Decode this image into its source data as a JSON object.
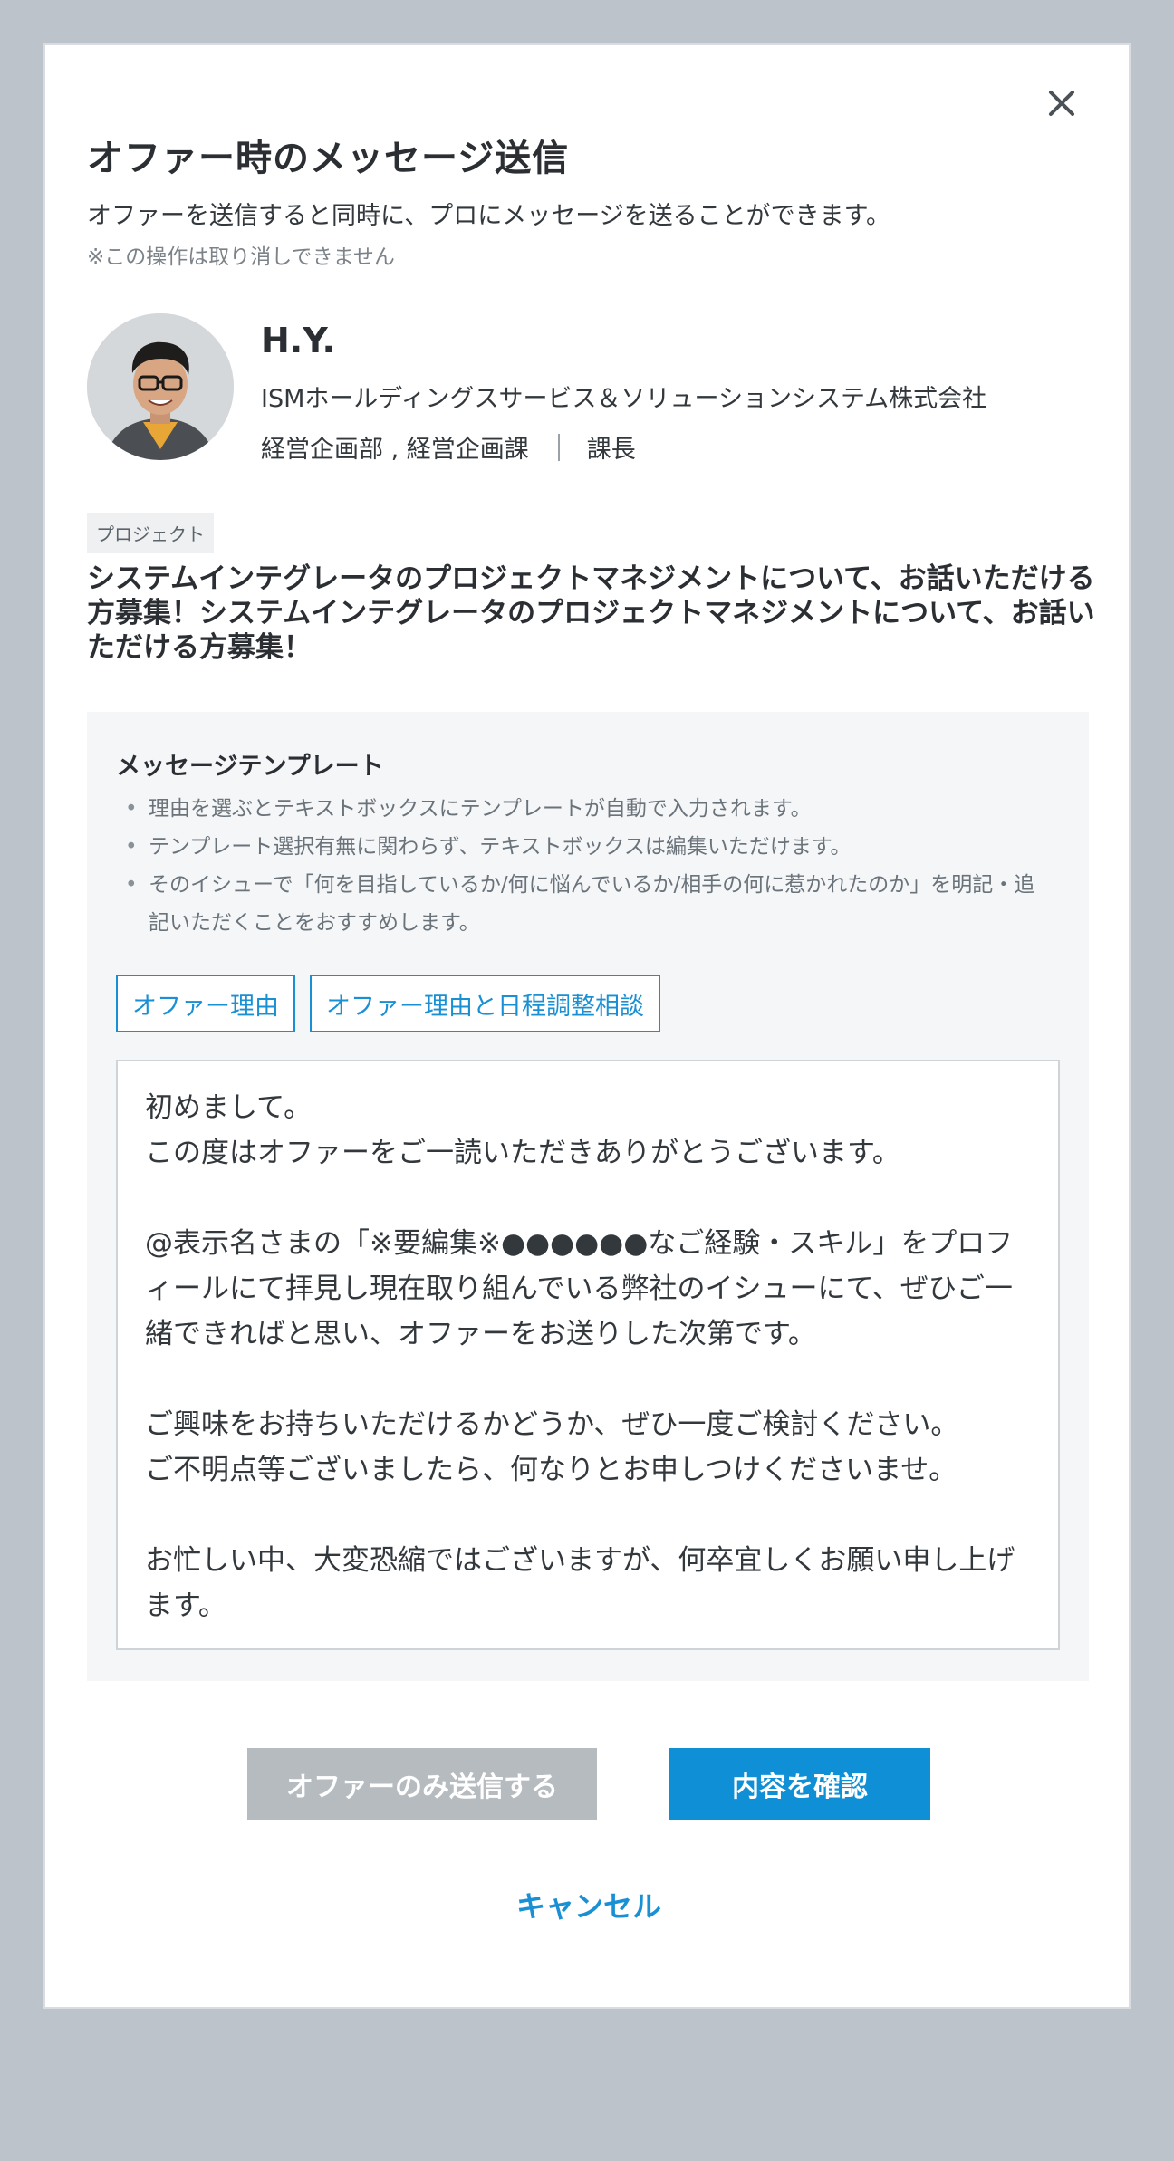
{
  "modal": {
    "title": "オファー時のメッセージ送信",
    "subtitle": "オファーを送信すると同時に、プロにメッセージを送ることができます。",
    "note": "※この操作は取り消しできません"
  },
  "profile": {
    "name": "H.Y.",
    "company": "ISMホールディングスサービス＆ソリューションシステム株式会社",
    "department": "経営企画部 , 経営企画課",
    "position": "課長"
  },
  "project": {
    "tag": "プロジェクト",
    "title": "システムインテグレータのプロジェクトマネジメントについて、お話いただける方募集！システムインテグレータのプロジェクトマネジメントについて、お話いただける方募集！"
  },
  "template": {
    "heading": "メッセージテンプレート",
    "notes": [
      "理由を選ぶとテキストボックスにテンプレートが自動で入力されます。",
      "テンプレート選択有無に関わらず、テキストボックスは編集いただけます。",
      "そのイシューで「何を目指しているか/何に悩んでいるか/相手の何に惹かれたのか」を明記・追記いただくことをおすすめします。"
    ],
    "buttons": [
      "オファー理由",
      "オファー理由と日程調整相談"
    ],
    "message": "初めまして。\nこの度はオファーをご一読いただきありがとうございます。\n\n@表示名さまの「※要編集※●●●●●●なご経験・スキル」をプロフィールにて拝見し現在取り組んでいる弊社のイシューにて、ぜひご一緒できればと思い、オファーをお送りした次第です。\n\nご興味をお持ちいただけるかどうか、ぜひ一度ご検討ください。\nご不明点等ございましたら、何なりとお申しつけくださいませ。\n\nお忙しい中、大変恐縮ではございますが、何卒宜しくお願い申し上げます。"
  },
  "actions": {
    "offer_only": "オファーのみ送信する",
    "confirm": "内容を確認",
    "cancel": "キャンセル"
  },
  "colors": {
    "accent": "#0f8fd6",
    "backdrop": "#bcc3ca",
    "disabled_button": "#b6bbc0"
  },
  "icons": {
    "close": "close-icon",
    "avatar": "avatar"
  }
}
